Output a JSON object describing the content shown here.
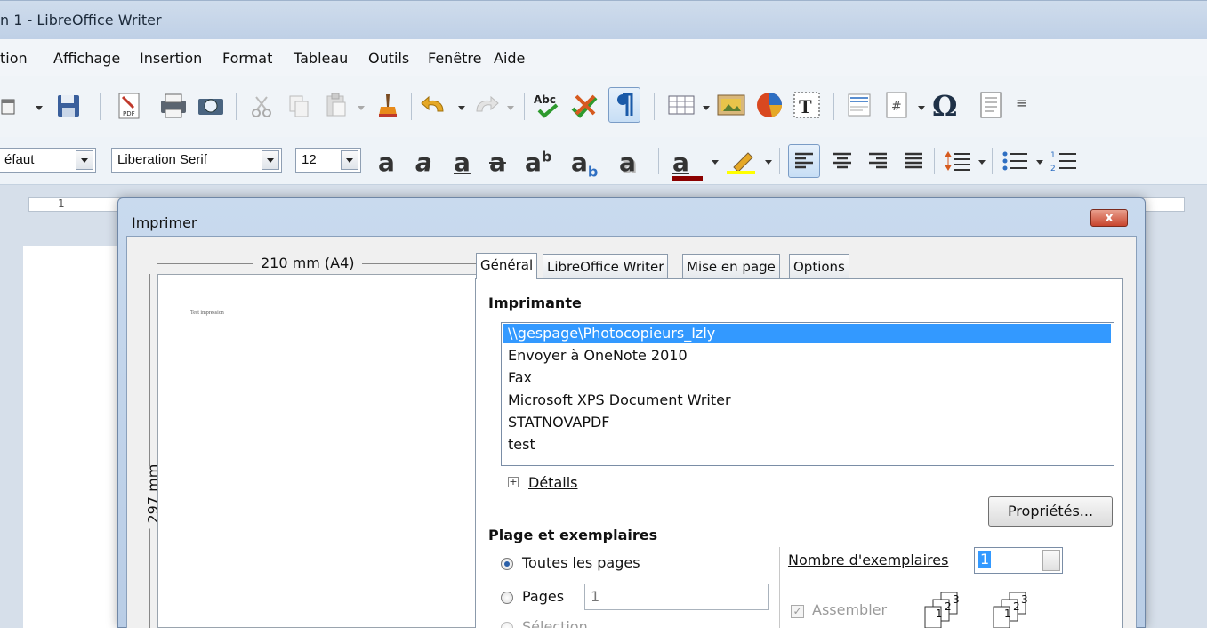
{
  "window": {
    "title": "n 1 - LibreOffice Writer"
  },
  "menu": [
    "tion",
    "Affichage",
    "Insertion",
    "Format",
    "Tableau",
    "Outils",
    "Fenêtre",
    "Aide"
  ],
  "toolbar_icons": [
    "new-icon",
    "save-icon",
    "export-pdf-icon",
    "print-icon",
    "print-preview-icon",
    "cut-icon",
    "copy-icon",
    "paste-icon",
    "clone-formatting-icon",
    "undo-icon",
    "redo-icon",
    "spellcheck-icon",
    "autospellcheck-icon",
    "formatting-marks-icon",
    "table-icon",
    "image-icon",
    "chart-icon",
    "textbox-icon",
    "header-icon",
    "field-icon",
    "special-character-icon",
    "navigator-icon"
  ],
  "formatting": {
    "style": "éfaut",
    "font": "Liberation Serif",
    "size": "12",
    "glyphs": {
      "bold": "a",
      "italic": "a",
      "underline": "a",
      "strike": "a",
      "superscript": "ab",
      "subscript": "ab",
      "shadow": "a",
      "fontcolor": "a"
    },
    "font_color": "#8b0000",
    "highlight_color": "#ffff00"
  },
  "ruler": {
    "mark": "1"
  },
  "dialog": {
    "title": "Imprimer",
    "close_label": "x",
    "preview": {
      "width_label": "210 mm (A4)",
      "height_label": "297 mm",
      "page_text": "Test impression"
    },
    "tabs": [
      "Général",
      "LibreOffice Writer",
      "Mise en page",
      "Options"
    ],
    "active_tab": "Général",
    "printer_section": "Imprimante",
    "printers": [
      "\\\\gespage\\Photocopieurs_Izly",
      "Envoyer à OneNote 2010",
      "Fax",
      "Microsoft XPS Document Writer",
      "STATNOVAPDF",
      "test"
    ],
    "selected_printer": "\\\\gespage\\Photocopieurs_Izly",
    "details_label": "Détails",
    "details_expander": "+",
    "properties_button": "Propriétés...",
    "range_section": "Plage et exemplaires",
    "all_pages_label": "Toutes les pages",
    "pages_label": "Pages",
    "pages_value": "1",
    "selection_label": "Sélection",
    "copies_label": "Nombre d'exemplaires",
    "copies_value": "1",
    "collate_label": "Assembler",
    "collate_check": "✓",
    "collate_pages": [
      "1",
      "2",
      "3"
    ]
  }
}
